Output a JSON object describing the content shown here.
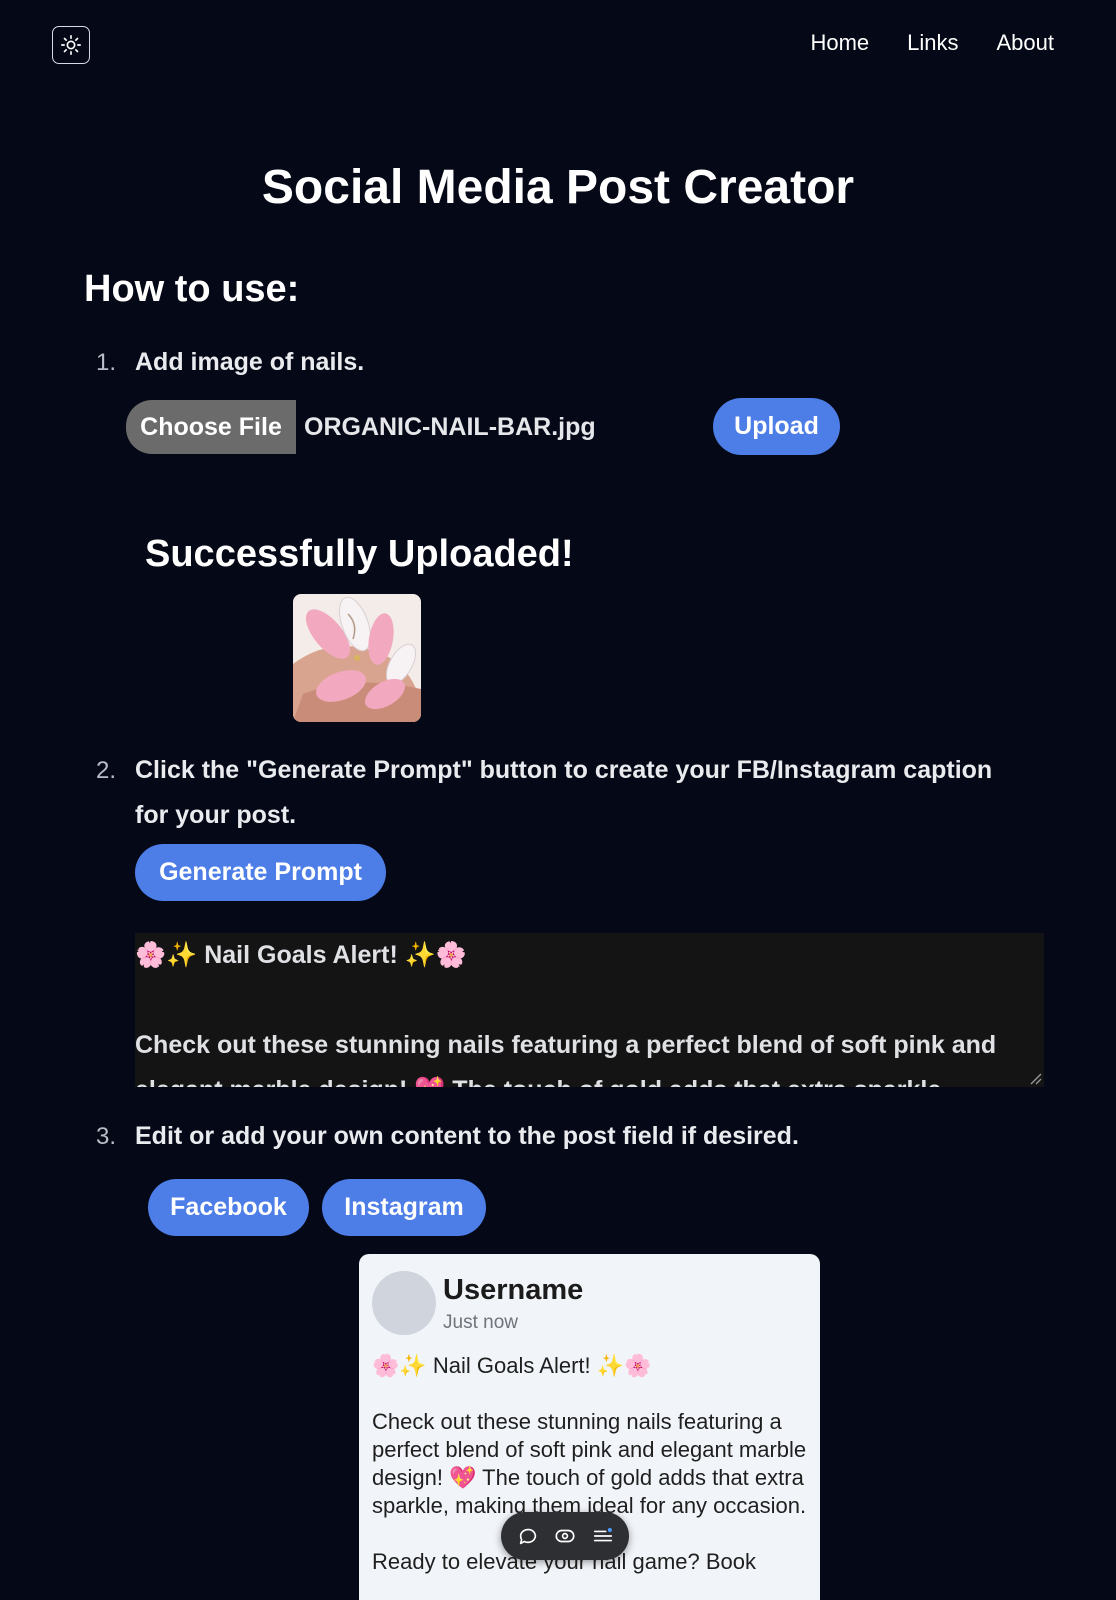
{
  "header": {
    "theme_toggle_icon": "sun-icon",
    "nav": [
      {
        "label": "Home"
      },
      {
        "label": "Links"
      },
      {
        "label": "About"
      }
    ]
  },
  "main": {
    "title": "Social Media Post Creator",
    "how_to_title": "How to use:",
    "steps": [
      {
        "number": "1.",
        "text": "Add image of nails."
      },
      {
        "number": "2.",
        "text_line1": "Click the \"Generate Prompt\" button to create your FB/Instagram caption",
        "text_line2": "for your post."
      },
      {
        "number": "3.",
        "text": "Edit or add your own content to the post field if desired."
      }
    ],
    "file_input": {
      "button_label": "Choose File",
      "file_name": "ORGANIC-NAIL-BAR.jpg"
    },
    "upload_button": "Upload",
    "success_message": "Successfully Uploaded!",
    "generate_button": "Generate Prompt",
    "caption": {
      "line1": "🌸✨ Nail Goals Alert! ✨🌸",
      "line2": "",
      "line3": "Check out these stunning nails featuring a perfect blend of soft pink and",
      "line4": "elegant marble design! 💖 The touch of gold adds that extra sparkle"
    },
    "platform_buttons": [
      {
        "label": "Facebook"
      },
      {
        "label": "Instagram"
      }
    ],
    "preview": {
      "username": "Username",
      "timestamp": "Just now",
      "headline": "🌸✨ Nail Goals Alert! ✨🌸",
      "paragraph1": "Check out these stunning nails featuring a perfect blend of soft pink and elegant marble design! 💖 The touch of gold adds that extra sparkle, making them ideal for any occasion.",
      "paragraph2": "Ready to elevate your nail game? Book"
    }
  },
  "floating_toolbar": {
    "icons": [
      "comment-icon",
      "eye-icon",
      "menu-icon"
    ]
  },
  "colors": {
    "background": "#050816",
    "accent": "#4d7de6",
    "card": "#f1f4f9"
  }
}
